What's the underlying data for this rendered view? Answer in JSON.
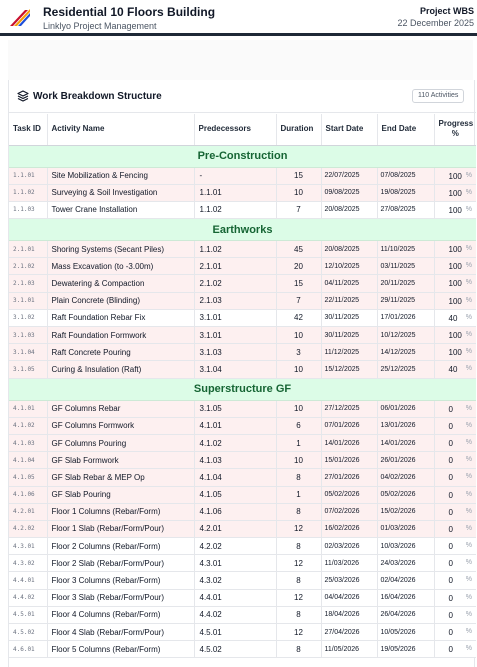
{
  "header": {
    "title": "Residential 10 Floors Building",
    "subtitle": "Linklyo Project Management",
    "label": "Project WBS",
    "date": "22 December 2025"
  },
  "card": {
    "title": "Work Breakdown Structure",
    "badge": "110 Activities"
  },
  "columns": [
    "Task ID",
    "Activity Name",
    "Predecessors",
    "Duration",
    "Start Date",
    "End Date",
    "Progress %"
  ],
  "sections": [
    {
      "title": "Pre-Construction",
      "rows": [
        {
          "id": "1.1.01",
          "name": "Site Mobilization & Fencing",
          "pred": "-",
          "dur": "15",
          "start": "22/07/2025",
          "end": "07/08/2025",
          "prog": "100",
          "pct": "%",
          "shade": "pink"
        },
        {
          "id": "1.1.02",
          "name": "Surveying & Soil Investigation",
          "pred": "1.1.01",
          "dur": "10",
          "start": "09/08/2025",
          "end": "19/08/2025",
          "prog": "100",
          "pct": "%",
          "shade": "pink"
        },
        {
          "id": "1.1.03",
          "name": "Tower Crane Installation",
          "pred": "1.1.02",
          "dur": "7",
          "start": "20/08/2025",
          "end": "27/08/2025",
          "prog": "100",
          "pct": "%",
          "shade": "white"
        }
      ]
    },
    {
      "title": "Earthworks",
      "rows": [
        {
          "id": "2.1.01",
          "name": "Shoring Systems (Secant Piles)",
          "pred": "1.1.02",
          "dur": "45",
          "start": "20/08/2025",
          "end": "11/10/2025",
          "prog": "100",
          "pct": "%",
          "shade": "pink"
        },
        {
          "id": "2.1.02",
          "name": "Mass Excavation (to -3.00m)",
          "pred": "2.1.01",
          "dur": "20",
          "start": "12/10/2025",
          "end": "03/11/2025",
          "prog": "100",
          "pct": "%",
          "shade": "pink"
        },
        {
          "id": "2.1.03",
          "name": "Dewatering & Compaction",
          "pred": "2.1.02",
          "dur": "15",
          "start": "04/11/2025",
          "end": "20/11/2025",
          "prog": "100",
          "pct": "%",
          "shade": "pink"
        },
        {
          "id": "3.1.01",
          "name": "Plain Concrete (Blinding)",
          "pred": "2.1.03",
          "dur": "7",
          "start": "22/11/2025",
          "end": "29/11/2025",
          "prog": "100",
          "pct": "%",
          "shade": "pink"
        },
        {
          "id": "3.1.02",
          "name": "Raft Foundation Rebar Fix",
          "pred": "3.1.01",
          "dur": "42",
          "start": "30/11/2025",
          "end": "17/01/2026",
          "prog": "40",
          "pct": "%",
          "shade": "white"
        },
        {
          "id": "3.1.03",
          "name": "Raft Foundation Formwork",
          "pred": "3.1.01",
          "dur": "10",
          "start": "30/11/2025",
          "end": "10/12/2025",
          "prog": "100",
          "pct": "%",
          "shade": "pink"
        },
        {
          "id": "3.1.04",
          "name": "Raft Concrete Pouring",
          "pred": "3.1.03",
          "dur": "3",
          "start": "11/12/2025",
          "end": "14/12/2025",
          "prog": "100",
          "pct": "%",
          "shade": "pink"
        },
        {
          "id": "3.1.05",
          "name": "Curing & Insulation (Raft)",
          "pred": "3.1.04",
          "dur": "10",
          "start": "15/12/2025",
          "end": "25/12/2025",
          "prog": "40",
          "pct": "%",
          "shade": "pink"
        }
      ]
    },
    {
      "title": "Superstructure GF",
      "rows": [
        {
          "id": "4.1.01",
          "name": "GF Columns Rebar",
          "pred": "3.1.05",
          "dur": "10",
          "start": "27/12/2025",
          "end": "06/01/2026",
          "prog": "0",
          "pct": "%",
          "shade": "pink"
        },
        {
          "id": "4.1.02",
          "name": "GF Columns Formwork",
          "pred": "4.1.01",
          "dur": "6",
          "start": "07/01/2026",
          "end": "13/01/2026",
          "prog": "0",
          "pct": "%",
          "shade": "pink"
        },
        {
          "id": "4.1.03",
          "name": "GF Columns Pouring",
          "pred": "4.1.02",
          "dur": "1",
          "start": "14/01/2026",
          "end": "14/01/2026",
          "prog": "0",
          "pct": "%",
          "shade": "pink"
        },
        {
          "id": "4.1.04",
          "name": "GF Slab Formwork",
          "pred": "4.1.03",
          "dur": "10",
          "start": "15/01/2026",
          "end": "26/01/2026",
          "prog": "0",
          "pct": "%",
          "shade": "pink"
        },
        {
          "id": "4.1.05",
          "name": "GF Slab Rebar & MEP Op",
          "pred": "4.1.04",
          "dur": "8",
          "start": "27/01/2026",
          "end": "04/02/2026",
          "prog": "0",
          "pct": "%",
          "shade": "pink"
        },
        {
          "id": "4.1.06",
          "name": "GF Slab Pouring",
          "pred": "4.1.05",
          "dur": "1",
          "start": "05/02/2026",
          "end": "05/02/2026",
          "prog": "0",
          "pct": "%",
          "shade": "pink"
        },
        {
          "id": "4.2.01",
          "name": "Floor 1 Columns (Rebar/Form)",
          "pred": "4.1.06",
          "dur": "8",
          "start": "07/02/2026",
          "end": "15/02/2026",
          "prog": "0",
          "pct": "%",
          "shade": "pink"
        },
        {
          "id": "4.2.02",
          "name": "Floor 1 Slab (Rebar/Form/Pour)",
          "pred": "4.2.01",
          "dur": "12",
          "start": "16/02/2026",
          "end": "01/03/2026",
          "prog": "0",
          "pct": "%",
          "shade": "pink"
        },
        {
          "id": "4.3.01",
          "name": "Floor 2 Columns (Rebar/Form)",
          "pred": "4.2.02",
          "dur": "8",
          "start": "02/03/2026",
          "end": "10/03/2026",
          "prog": "0",
          "pct": "%",
          "shade": "white"
        },
        {
          "id": "4.3.02",
          "name": "Floor 2 Slab (Rebar/Form/Pour)",
          "pred": "4.3.01",
          "dur": "12",
          "start": "11/03/2026",
          "end": "24/03/2026",
          "prog": "0",
          "pct": "%",
          "shade": "white"
        },
        {
          "id": "4.4.01",
          "name": "Floor 3 Columns (Rebar/Form)",
          "pred": "4.3.02",
          "dur": "8",
          "start": "25/03/2026",
          "end": "02/04/2026",
          "prog": "0",
          "pct": "%",
          "shade": "white"
        },
        {
          "id": "4.4.02",
          "name": "Floor 3 Slab (Rebar/Form/Pour)",
          "pred": "4.4.01",
          "dur": "12",
          "start": "04/04/2026",
          "end": "16/04/2026",
          "prog": "0",
          "pct": "%",
          "shade": "white"
        },
        {
          "id": "4.5.01",
          "name": "Floor 4 Columns (Rebar/Form)",
          "pred": "4.4.02",
          "dur": "8",
          "start": "18/04/2026",
          "end": "26/04/2026",
          "prog": "0",
          "pct": "%",
          "shade": "white"
        },
        {
          "id": "4.5.02",
          "name": "Floor 4 Slab (Rebar/Form/Pour)",
          "pred": "4.5.01",
          "dur": "12",
          "start": "27/04/2026",
          "end": "10/05/2026",
          "prog": "0",
          "pct": "%",
          "shade": "white"
        },
        {
          "id": "4.6.01",
          "name": "Floor 5 Columns (Rebar/Form)",
          "pred": "4.5.02",
          "dur": "8",
          "start": "11/05/2026",
          "end": "19/05/2026",
          "prog": "0",
          "pct": "%",
          "shade": "white"
        }
      ]
    }
  ],
  "icons": {
    "logo": "pen-stripes-logo",
    "card": "layers-icon"
  },
  "colors": {
    "section_bg": "#dcfce7",
    "section_text": "#166534",
    "row_pink": "#fdf0f0"
  }
}
